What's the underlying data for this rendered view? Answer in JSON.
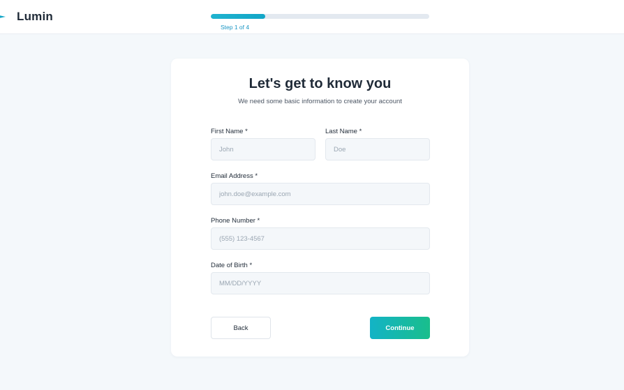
{
  "header": {
    "brand": "Lumin",
    "logo_icon": "arrow-icon",
    "progress": {
      "current_step": 1,
      "total_steps": 4,
      "fraction": 0.25,
      "label": "Step 1 of 4"
    }
  },
  "form": {
    "title": "Let's get to know you",
    "subtitle": "We need some basic information to create your account",
    "fields": {
      "first_name": {
        "label": "First Name *",
        "placeholder": "John",
        "value": ""
      },
      "last_name": {
        "label": "Last Name *",
        "placeholder": "Doe",
        "value": ""
      },
      "email": {
        "label": "Email Address *",
        "placeholder": "john.doe@example.com",
        "value": ""
      },
      "phone": {
        "label": "Phone Number *",
        "placeholder": "(555) 123-4567",
        "value": ""
      },
      "dob": {
        "label": "Date of Birth *",
        "placeholder": "MM/DD/YYYY",
        "value": ""
      }
    },
    "buttons": {
      "back": "Back",
      "continue": "Continue"
    }
  },
  "colors": {
    "accent": "#12a6c7",
    "accent_gradient_end": "#19be8c",
    "page_bg": "#f4f8fb",
    "step_text": "#1a96c4"
  }
}
